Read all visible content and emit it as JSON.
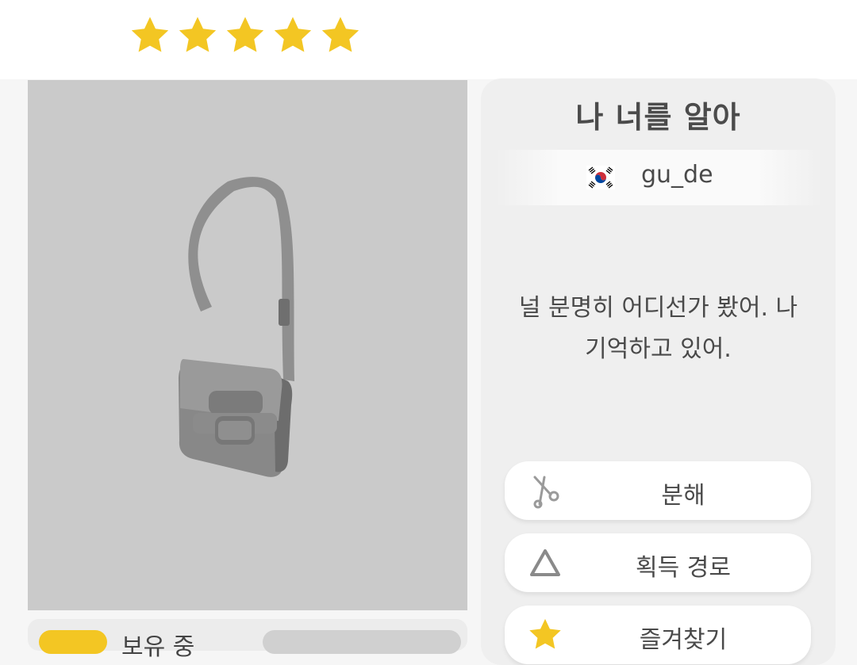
{
  "rating": {
    "stars": 5,
    "max": 5,
    "star_color": "#f3c623"
  },
  "item": {
    "image_name": "gray-shoulder-bag",
    "owned_label": "보유 중",
    "colors": {
      "image_bg": "#cacaca",
      "count_pill": "#f3c623"
    }
  },
  "panel": {
    "title": "나 너를 알아",
    "author": {
      "flag": "south-korea-flag",
      "name": "gu_de"
    },
    "description": "널 분명히 어디선가 봤어. 나 기억하고 있어.",
    "buttons": [
      {
        "label": "분해",
        "icon": "scissors-icon"
      },
      {
        "label": "획득 경로",
        "icon": "triangle-icon"
      },
      {
        "label": "즐겨찾기",
        "icon": "star-icon"
      }
    ]
  }
}
